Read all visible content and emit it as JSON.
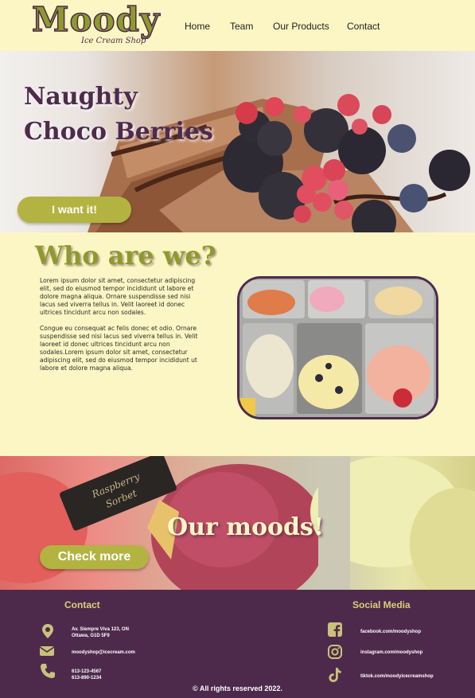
{
  "logo": {
    "name": "Moody",
    "subtitle": "Ice Cream Shop"
  },
  "nav": {
    "items": [
      "Home",
      "Team",
      "Our Products",
      "Contact"
    ]
  },
  "hero": {
    "title_line1": "Naughty",
    "title_line2": "Choco Berries",
    "button": "I want it!"
  },
  "about": {
    "title": "Who are we?",
    "paragraph1": "Lorem ipsum dolor sit amet, consectetur adipiscing elit, sed do eiusmod tempor incididunt ut labore et dolore magna aliqua. Ornare suspendisse sed nisi lacus sed viverra tellus in. Velit laoreet id donec ultrices tincidunt arcu non sodales.",
    "paragraph2": "Congue eu consequat ac felis donec et odio. Ornare suspendisse sed nisi lacus sed viverra tellus in. Velit laoreet id donec ultrices tincidunt arcu non sodales.Lorem ipsum dolor sit amet, consectetur adipiscing elit, sed do eiusmod tempor incididunt ut labore et dolore magna aliqua."
  },
  "moods": {
    "title": "Our moods!",
    "button": "Check more",
    "sign_text": "Raspberry Sorbet"
  },
  "footer": {
    "contact_heading": "Contact",
    "address_line1": "Av. Siempre Viva 123, ON",
    "address_line2": "Ottawa, G1D 5F9",
    "email": "moodyshop@icecream.com",
    "phone1": "613-123-4567",
    "phone2": "613-890-1234",
    "social_heading": "Social Media",
    "facebook": "facebook.com/moodyshop",
    "instagram": "instagram.com/moodyshop",
    "tiktok": "tiktok.com/moodyicecreamshop",
    "copyright": "© All rights reserved 2022."
  },
  "colors": {
    "cream": "#fcf6c4",
    "olive": "#8e9a2d",
    "button": "#b3b341",
    "plum": "#4d2a4c",
    "gold": "#d8cf7a"
  }
}
